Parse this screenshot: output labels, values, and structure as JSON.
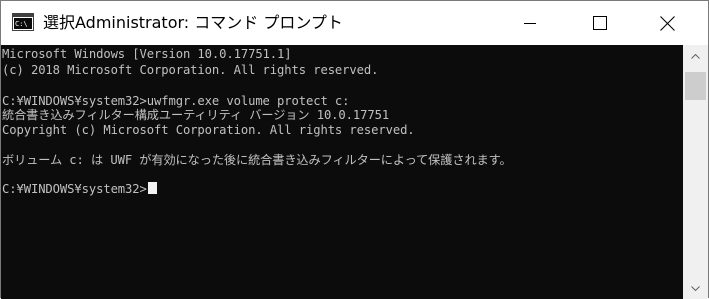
{
  "window": {
    "title": "選択Administrator: コマンド プロンプト",
    "icon": "command-prompt-icon",
    "controls": [
      "minimize-icon",
      "maximize-icon",
      "close-icon"
    ]
  },
  "console": {
    "lines": [
      "Microsoft Windows [Version 10.0.17751.1]",
      "(c) 2018 Microsoft Corporation. All rights reserved.",
      "",
      "C:¥WINDOWS¥system32>uwfmgr.exe volume protect c:",
      "統合書き込みフィルター構成ユーティリティ バージョン 10.0.17751",
      "Copyright (c) Microsoft Corporation. All rights reserved.",
      "",
      "ボリューム c: は UWF が有効になった後に統合書き込みフィルターによって保護されます。",
      "",
      "C:¥WINDOWS¥system32>"
    ]
  },
  "colors": {
    "console_background": "#0c0c0c",
    "console_text": "#c0c0c0",
    "titlebar_background": "#ffffff",
    "scrollbar_track": "#f0f0f0",
    "scrollbar_thumb": "#cdcdcd"
  }
}
